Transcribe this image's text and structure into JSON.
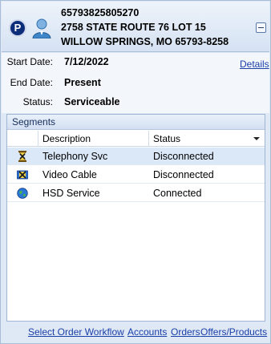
{
  "header": {
    "account_number": "65793825805270",
    "address_line1": "2758 STATE ROUTE 76 LOT 15",
    "address_line2": "WILLOW SPRINGS, MO 65793-8258",
    "badge_letter": "P",
    "badge_icon": "p-badge-icon",
    "person_icon": "person-icon",
    "collapse_icon": "collapse-minus-icon"
  },
  "info": {
    "start_label": "Start Date:",
    "start_value": "7/12/2022",
    "end_label": "End Date:",
    "end_value": "Present",
    "status_label": "Status:",
    "status_value": "Serviceable",
    "details_link": "Details"
  },
  "segments": {
    "title": "Segments",
    "columns": [
      "Description",
      "Status"
    ],
    "rows": [
      {
        "icon": "hourglass-x-icon",
        "description": "Telephony Svc",
        "status": "Disconnected",
        "selected": true
      },
      {
        "icon": "video-x-icon",
        "description": "Video Cable",
        "status": "Disconnected",
        "selected": false
      },
      {
        "icon": "globe-icon",
        "description": "HSD Service",
        "status": "Connected",
        "selected": false
      }
    ]
  },
  "footer": {
    "links": [
      "Select Order Workflow",
      "Accounts",
      "Orders",
      "Offers/Products"
    ]
  },
  "colors": {
    "link": "#1a3fa8",
    "header_bg": "#d5e2f3",
    "badge": "#0c2d7a",
    "selected_row": "#dbe8f8"
  }
}
